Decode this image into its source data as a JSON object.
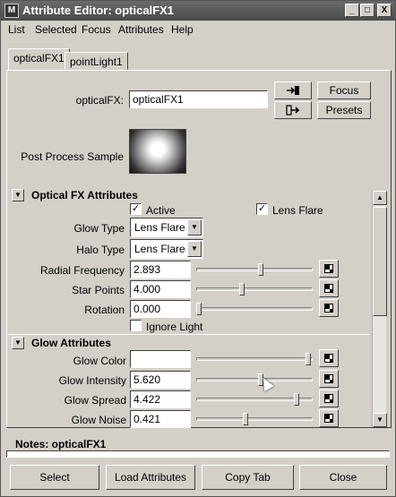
{
  "window": {
    "title": "Attribute Editor: opticalFX1",
    "controls": {
      "minimize": "_",
      "maximize": "□",
      "close": "X"
    }
  },
  "menubar": [
    "List",
    "Selected",
    "Focus",
    "Attributes",
    "Help"
  ],
  "tabs": [
    {
      "label": "opticalFX1",
      "active": true
    },
    {
      "label": "pointLight1",
      "active": false
    }
  ],
  "node": {
    "type_label": "opticalFX:",
    "name_value": "opticalFX1",
    "focus_label": "Focus",
    "presets_label": "Presets",
    "sample_label": "Post Process Sample"
  },
  "optical_section": {
    "title": "Optical FX Attributes",
    "active_label": "Active",
    "active_checked": true,
    "lens_flare_label": "Lens Flare",
    "lens_flare_checked": true,
    "glow_type_label": "Glow Type",
    "glow_type_value": "Lens Flare",
    "halo_type_label": "Halo Type",
    "halo_type_value": "Lens Flare",
    "rows": [
      {
        "label": "Radial Frequency",
        "value": "2.893",
        "slider_fraction": 0.56
      },
      {
        "label": "Star Points",
        "value": "4.000",
        "slider_fraction": 0.39
      },
      {
        "label": "Rotation",
        "value": "0.000",
        "slider_fraction": 0.0
      }
    ],
    "ignore_light_label": "Ignore Light",
    "ignore_light_checked": false
  },
  "glow_section": {
    "title": "Glow Attributes",
    "color_label": "Glow Color",
    "color_value": "#ffffff",
    "color_slider_fraction": 0.98,
    "rows": [
      {
        "label": "Glow Intensity",
        "value": "5.620",
        "slider_fraction": 0.56
      },
      {
        "label": "Glow Spread",
        "value": "4.422",
        "slider_fraction": 0.88
      },
      {
        "label": "Glow Noise",
        "value": "0.421",
        "slider_fraction": 0.42
      }
    ]
  },
  "notes": {
    "label": "Notes:  opticalFX1"
  },
  "bottom_buttons": [
    "Select",
    "Load Attributes",
    "Copy Tab",
    "Close"
  ]
}
